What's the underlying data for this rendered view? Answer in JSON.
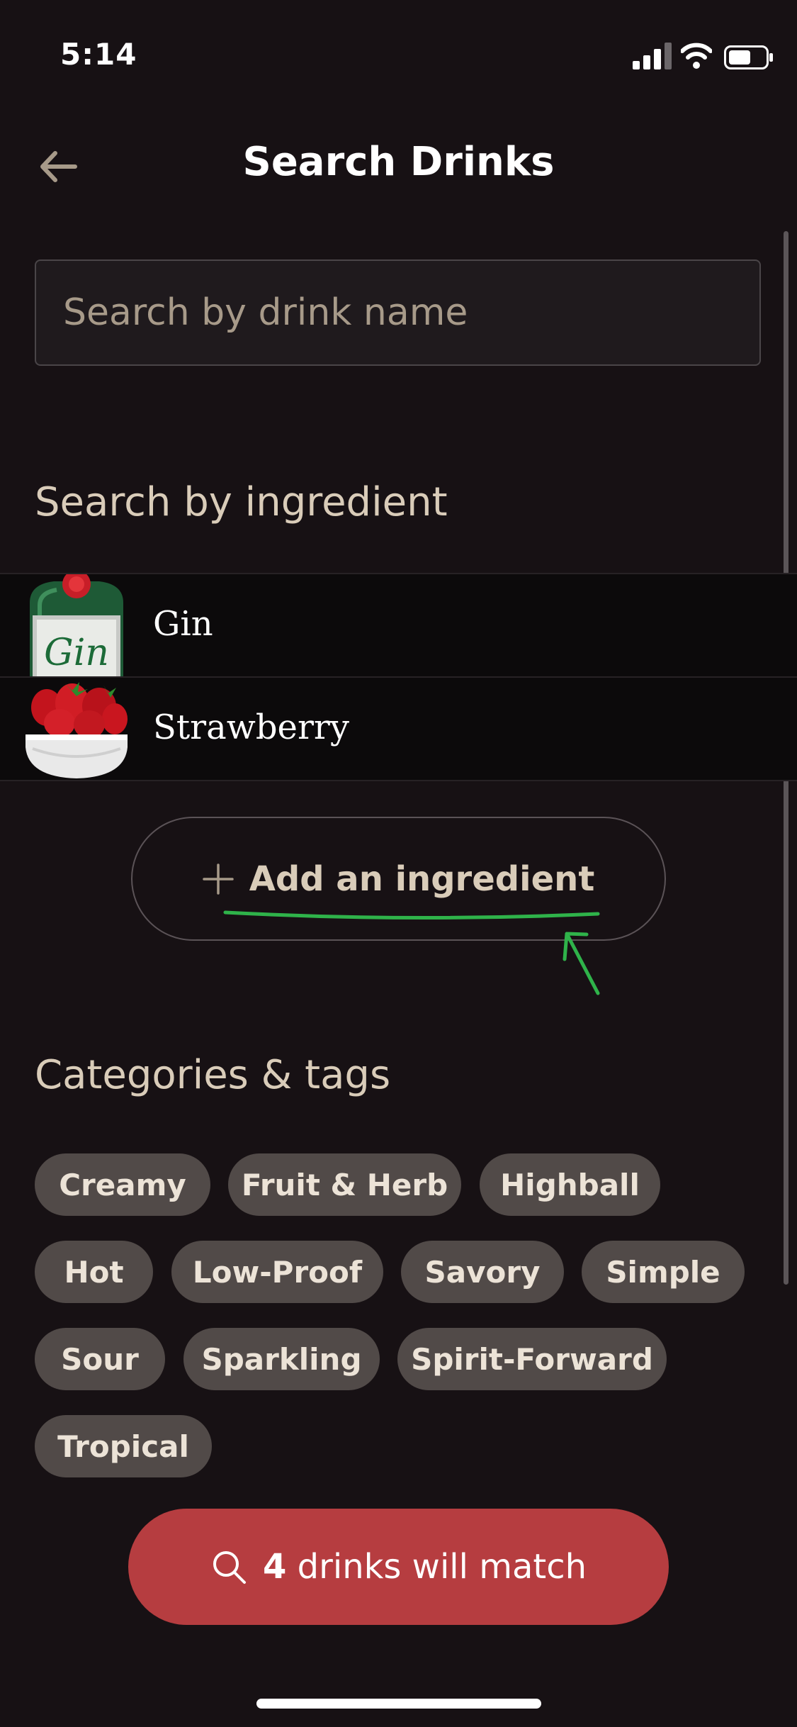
{
  "status_bar": {
    "time": "5:14",
    "icons": [
      "cellular-signal-icon",
      "wifi-icon",
      "battery-icon"
    ]
  },
  "header": {
    "title": "Search Drinks",
    "back_icon": "arrow-left-icon"
  },
  "search": {
    "placeholder": "Search by drink name",
    "value": ""
  },
  "ingredients_section": {
    "heading": "Search by ingredient",
    "items": [
      {
        "name": "Gin",
        "image": "gin-bottle"
      },
      {
        "name": "Strawberry",
        "image": "strawberry-bowl"
      }
    ],
    "add_label": "Add an ingredient",
    "add_icon": "plus-icon"
  },
  "categories_section": {
    "heading": "Categories & tags",
    "tags": [
      "Creamy",
      "Fruit & Herb",
      "Highball",
      "Hot",
      "Low-Proof",
      "Savory",
      "Simple",
      "Sour",
      "Sparkling",
      "Spirit-Forward",
      "Tropical"
    ]
  },
  "cta": {
    "count": "4",
    "label": "drinks will match",
    "icon": "search-icon"
  },
  "colors": {
    "background": "#171114",
    "accent": "#b63d40",
    "tag_bg": "#514a48",
    "heading": "#d9ccb9",
    "annotation": "#2fb34a"
  }
}
